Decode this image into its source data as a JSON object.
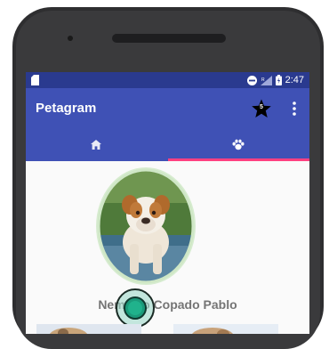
{
  "status_bar": {
    "time": "2:47"
  },
  "app_bar": {
    "title": "Petagram",
    "favorites_badge": "5"
  },
  "tabs": [
    {
      "icon": "home-icon",
      "selected": false
    },
    {
      "icon": "paw-icon",
      "selected": true
    }
  ],
  "profile": {
    "name": "Nemesio Copado Pablo"
  },
  "colors": {
    "primary": "#3f51b5",
    "primary_dark": "#2a3a8f",
    "accent": "#ff4081",
    "touch_indicator": "#1b9a7a"
  }
}
